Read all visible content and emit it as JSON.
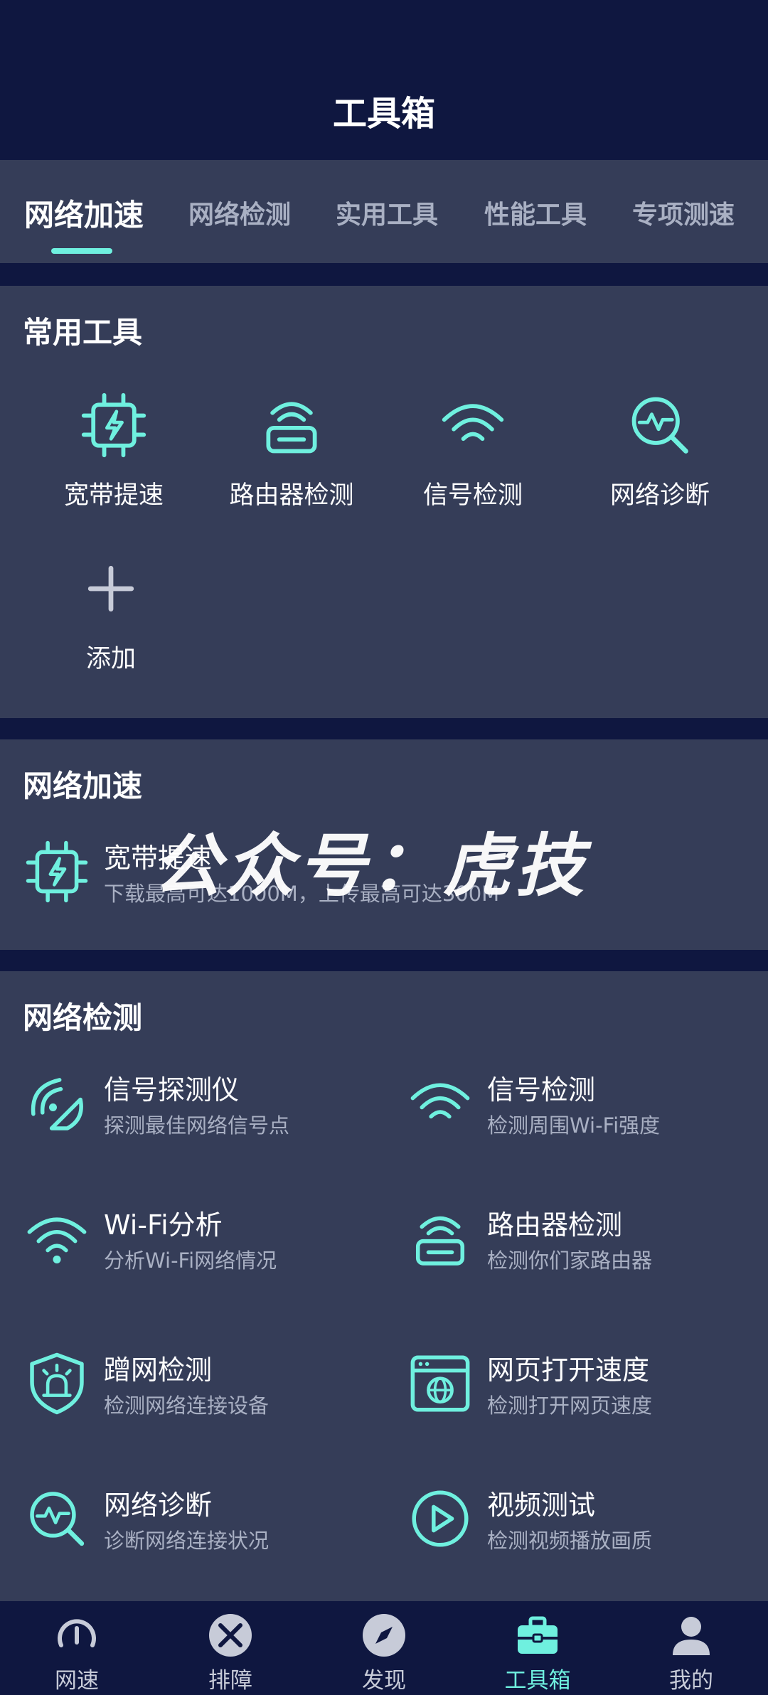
{
  "header": {
    "title": "工具箱"
  },
  "tabs": [
    {
      "label": "网络加速",
      "active": true
    },
    {
      "label": "网络检测",
      "active": false
    },
    {
      "label": "实用工具",
      "active": false
    },
    {
      "label": "性能工具",
      "active": false
    },
    {
      "label": "专项测速",
      "active": false
    }
  ],
  "common_tools": {
    "title": "常用工具",
    "items": [
      {
        "label": "宽带提速",
        "icon": "chip-bolt-icon"
      },
      {
        "label": "路由器检测",
        "icon": "router-icon"
      },
      {
        "label": "信号检测",
        "icon": "wifi-icon"
      },
      {
        "label": "网络诊断",
        "icon": "magnifier-pulse-icon"
      },
      {
        "label": "添加",
        "icon": "plus-icon"
      }
    ]
  },
  "network_accel": {
    "title": "网络加速",
    "items": [
      {
        "title": "宽带提速",
        "subtitle": "下载最高可达1000M，上传最高可达300M",
        "icon": "chip-bolt-icon"
      }
    ]
  },
  "network_detect": {
    "title": "网络检测",
    "items": [
      {
        "title": "信号探测仪",
        "subtitle": "探测最佳网络信号点",
        "icon": "signal-radar-icon"
      },
      {
        "title": "信号检测",
        "subtitle": "检测周围Wi-Fi强度",
        "icon": "wifi-icon"
      },
      {
        "title": "Wi-Fi分析",
        "subtitle": "分析Wi-Fi网络情况",
        "icon": "wifi-analysis-icon"
      },
      {
        "title": "路由器检测",
        "subtitle": "检测你们家路由器",
        "icon": "router-icon"
      },
      {
        "title": "蹭网检测",
        "subtitle": "检测网络连接设备",
        "icon": "shield-alarm-icon"
      },
      {
        "title": "网页打开速度",
        "subtitle": "检测打开网页速度",
        "icon": "browser-globe-icon"
      },
      {
        "title": "网络诊断",
        "subtitle": "诊断网络连接状况",
        "icon": "magnifier-pulse-icon"
      },
      {
        "title": "视频测试",
        "subtitle": "检测视频播放画质",
        "icon": "play-circle-icon"
      }
    ]
  },
  "watermark": "公众号：虎技",
  "bottom_nav": [
    {
      "label": "网速",
      "icon": "speedometer-icon",
      "active": false
    },
    {
      "label": "排障",
      "icon": "tools-icon",
      "active": false
    },
    {
      "label": "发现",
      "icon": "compass-icon",
      "active": false
    },
    {
      "label": "工具箱",
      "icon": "toolbox-icon",
      "active": true
    },
    {
      "label": "我的",
      "icon": "user-icon",
      "active": false
    }
  ],
  "colors": {
    "background": "#0f1740",
    "card": "#353d58",
    "accent": "#6ff0df",
    "muted_text": "#a9b0c3"
  }
}
